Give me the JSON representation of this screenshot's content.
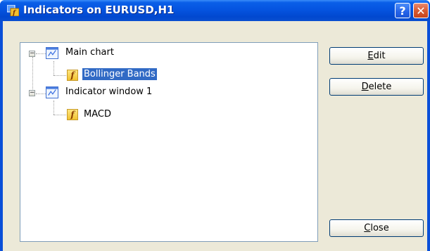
{
  "window": {
    "title": "Indicators on EURUSD,H1",
    "help_label": "?",
    "close_label": "✕"
  },
  "tree": {
    "items": [
      {
        "label": "Main chart",
        "expander": "−"
      },
      {
        "label": "Bollinger Bands",
        "icon": "f"
      },
      {
        "label": "Indicator window 1",
        "expander": "−"
      },
      {
        "label": "MACD",
        "icon": "f"
      }
    ]
  },
  "buttons": {
    "edit": {
      "accel": "E",
      "rest": "dit"
    },
    "delete": {
      "accel": "D",
      "rest": "elete"
    },
    "close": {
      "accel": "C",
      "rest": "lose"
    }
  }
}
